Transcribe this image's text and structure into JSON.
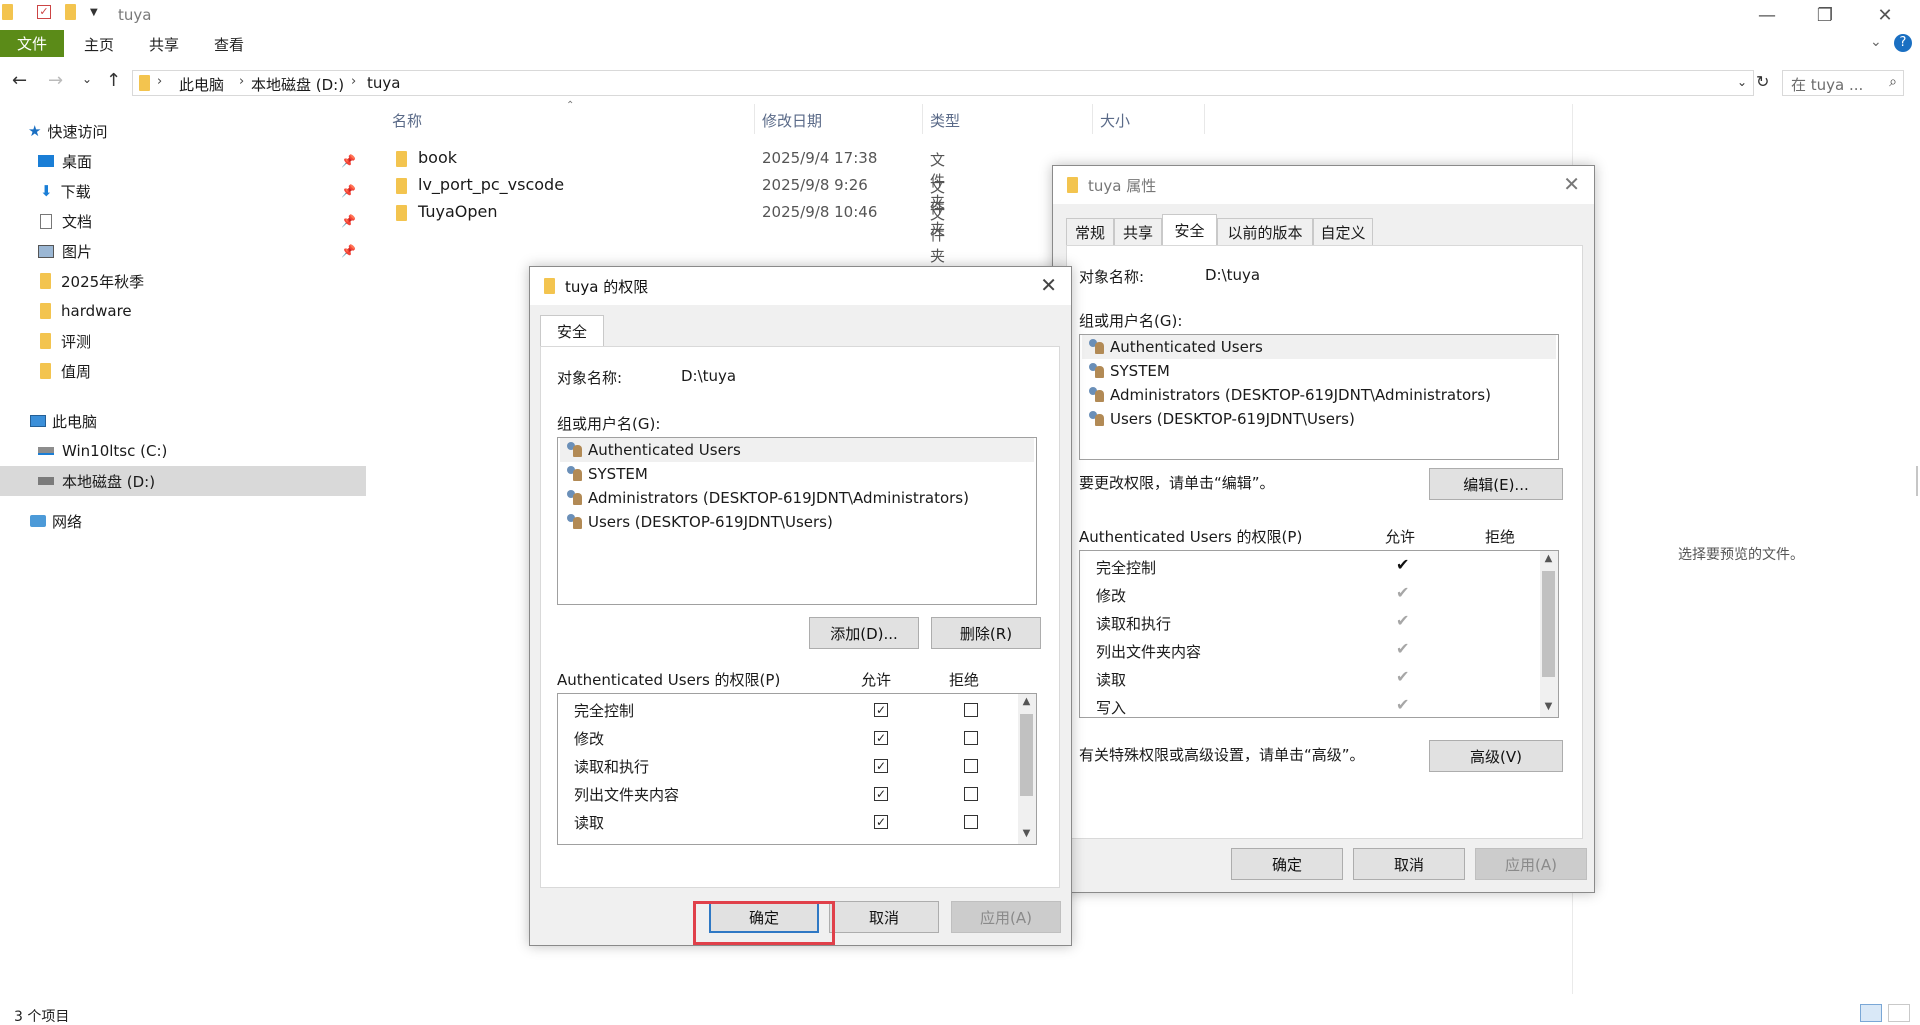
{
  "window": {
    "title": "tuya"
  },
  "ribbon": {
    "file": "文件",
    "tabs": [
      "主页",
      "共享",
      "查看"
    ]
  },
  "address": {
    "crumbs": [
      "此电脑",
      "本地磁盘 (D:)",
      "tuya"
    ],
    "search_placeholder": "在 tuya ..."
  },
  "nav": {
    "quick_access": "快速访问",
    "quick_items": [
      "桌面",
      "下载",
      "文档",
      "图片",
      "2025年秋季",
      "hardware",
      "评测",
      "值周"
    ],
    "this_pc": "此电脑",
    "drives": [
      "Win10ltsc (C:)",
      "本地磁盘 (D:)"
    ],
    "network": "网络"
  },
  "columns": {
    "name": "名称",
    "date": "修改日期",
    "type": "类型",
    "size": "大小"
  },
  "files": [
    {
      "name": "book",
      "date": "2025/9/4 17:38",
      "type": "文件夹"
    },
    {
      "name": "lv_port_pc_vscode",
      "date": "2025/9/8 9:26",
      "type": "文件夹"
    },
    {
      "name": "TuyaOpen",
      "date": "2025/9/8 10:46",
      "type": "文件夹"
    }
  ],
  "preview_text": "选择要预览的文件。",
  "status_text": "3 个项目",
  "props": {
    "title": "tuya 属性",
    "tabs": [
      "常规",
      "共享",
      "安全",
      "以前的版本",
      "自定义"
    ],
    "object_label": "对象名称:",
    "object_value": "D:\\tuya",
    "groups_label": "组或用户名(G):",
    "users": [
      "Authenticated Users",
      "SYSTEM",
      "Administrators (DESKTOP-619JDNT\\Administrators)",
      "Users (DESKTOP-619JDNT\\Users)"
    ],
    "edit_hint": "要更改权限，请单击“编辑”。",
    "edit_button": "编辑(E)...",
    "perm_label": "Authenticated Users 的权限(P)",
    "allow": "允许",
    "deny": "拒绝",
    "perms": [
      "完全控制",
      "修改",
      "读取和执行",
      "列出文件夹内容",
      "读取",
      "写入"
    ],
    "adv_hint": "有关特殊权限或高级设置，请单击“高级”。",
    "adv_button": "高级(V)",
    "ok": "确定",
    "cancel": "取消",
    "apply": "应用(A)"
  },
  "perm_dlg": {
    "title": "tuya 的权限",
    "tab": "安全",
    "object_label": "对象名称:",
    "object_value": "D:\\tuya",
    "groups_label": "组或用户名(G):",
    "users": [
      "Authenticated Users",
      "SYSTEM",
      "Administrators (DESKTOP-619JDNT\\Administrators)",
      "Users (DESKTOP-619JDNT\\Users)"
    ],
    "add_button": "添加(D)...",
    "remove_button": "删除(R)",
    "perm_label": "Authenticated Users 的权限(P)",
    "allow": "允许",
    "deny": "拒绝",
    "perms": [
      "完全控制",
      "修改",
      "读取和执行",
      "列出文件夹内容",
      "读取"
    ],
    "ok": "确定",
    "cancel": "取消",
    "apply": "应用(A)"
  }
}
